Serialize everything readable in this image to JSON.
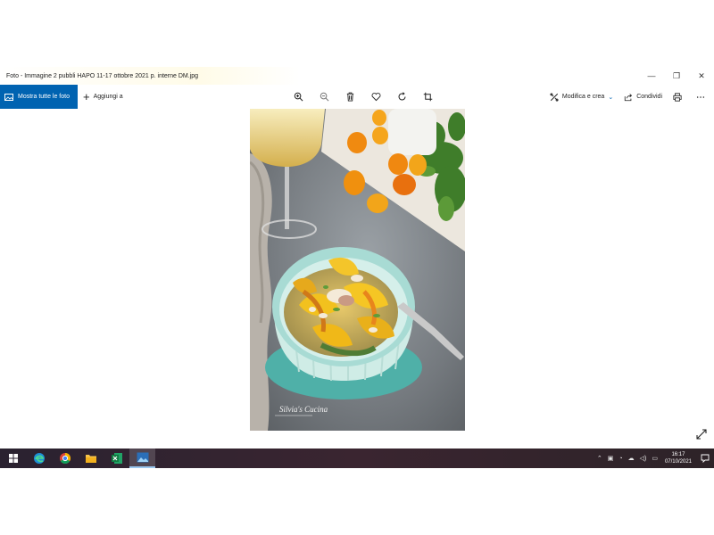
{
  "window": {
    "title": "Foto - Immagine 2 pubbli HAPO 11-17 ottobre 2021 p. interne DM.jpg",
    "controls": [
      "—",
      "❐",
      "✕"
    ]
  },
  "toolbar": {
    "show_all_label": "Mostra tutte le foto",
    "add_to_label": "Aggiungi a",
    "tools": [
      "zoom-in-icon",
      "zoom-out-icon",
      "delete-icon",
      "favorite-icon",
      "rotate-icon",
      "crop-icon"
    ],
    "edit_create_label": "Modifica e crea",
    "share_label": "Condividi"
  },
  "photo": {
    "signature_text": "Silvia's Cucina"
  },
  "taskbar": {
    "apps": [
      "edge-icon",
      "chrome-icon",
      "file-explorer-icon",
      "excel-icon",
      "photos-icon"
    ],
    "clock_time": "16:17",
    "clock_date": "07/10/2021"
  },
  "colors": {
    "accent": "#0063b1",
    "taskbar": "#2d2328"
  }
}
